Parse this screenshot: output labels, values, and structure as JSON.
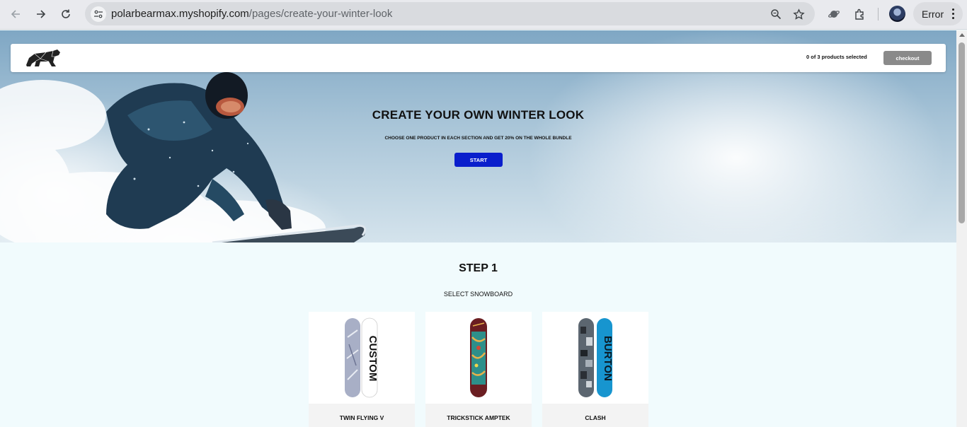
{
  "browser": {
    "url_host": "polarbearmax.myshopify.com",
    "url_path": "/pages/create-your-winter-look",
    "profile_status": "Error",
    "icons": [
      "back-arrow-icon",
      "forward-arrow-icon",
      "reload-icon",
      "site-info-icon",
      "zoom-icon",
      "bookmark-star-icon",
      "planet-extension-icon",
      "puzzle-extension-icon",
      "profile-avatar",
      "kebab-menu-icon"
    ]
  },
  "store_header": {
    "logo": "polar-bear-logo",
    "selection_count": "0 of 3 products selected",
    "checkout_label": "checkout"
  },
  "hero": {
    "title": "CREATE YOUR OWN WINTER LOOK",
    "subtitle": "CHOOSE ONE PRODUCT IN EACH SECTION AND GET 20% ON THE WHOLE BUNDLE",
    "start_label": "START"
  },
  "step": {
    "title": "STEP 1",
    "subtitle": "SELECT SNOWBOARD",
    "products": [
      {
        "name": "TWIN FLYING V"
      },
      {
        "name": "TRICKSTICK AMPTEK"
      },
      {
        "name": "CLASH"
      }
    ]
  },
  "colors": {
    "start_button": "#0a1ecc",
    "checkout_button": "#8a8a8a",
    "page_background": "#f1fbfd"
  }
}
